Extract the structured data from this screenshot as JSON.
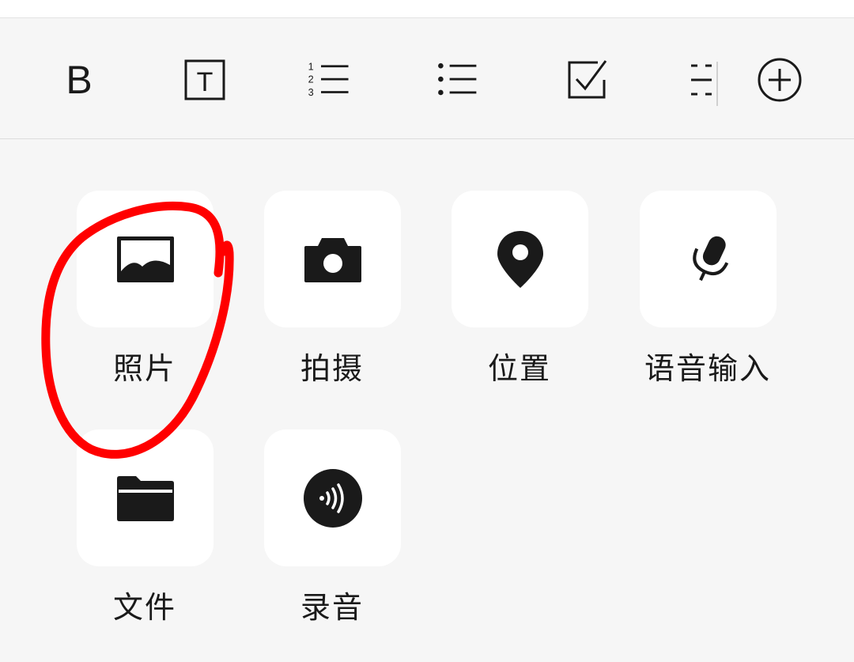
{
  "toolbar": {
    "tools": [
      {
        "name": "bold",
        "icon": "bold-icon",
        "glyph": "B"
      },
      {
        "name": "text-style",
        "icon": "text-box-icon",
        "glyph": "T"
      },
      {
        "name": "numbered-list",
        "icon": "numbered-list-icon",
        "glyph": "1 2 3"
      },
      {
        "name": "bulleted-list",
        "icon": "bulleted-list-icon"
      },
      {
        "name": "checklist",
        "icon": "checkbox-icon"
      },
      {
        "name": "divider",
        "icon": "divider-icon"
      },
      {
        "name": "more",
        "icon": "plus-circle-icon"
      }
    ]
  },
  "attachments": {
    "items": [
      {
        "icon": "image-icon",
        "label": "照片"
      },
      {
        "icon": "camera-icon",
        "label": "拍摄"
      },
      {
        "icon": "location-pin-icon",
        "label": "位置"
      },
      {
        "icon": "microphone-icon",
        "label": "语音输入"
      },
      {
        "icon": "folder-icon",
        "label": "文件"
      },
      {
        "icon": "audio-record-icon",
        "label": "录音"
      }
    ]
  },
  "annotation": {
    "shape": "freehand-circle",
    "target": "照片",
    "color": "#ff0000"
  },
  "colors": {
    "icon": "#1a1a1a",
    "background": "#f6f6f6",
    "tile": "#ffffff"
  }
}
